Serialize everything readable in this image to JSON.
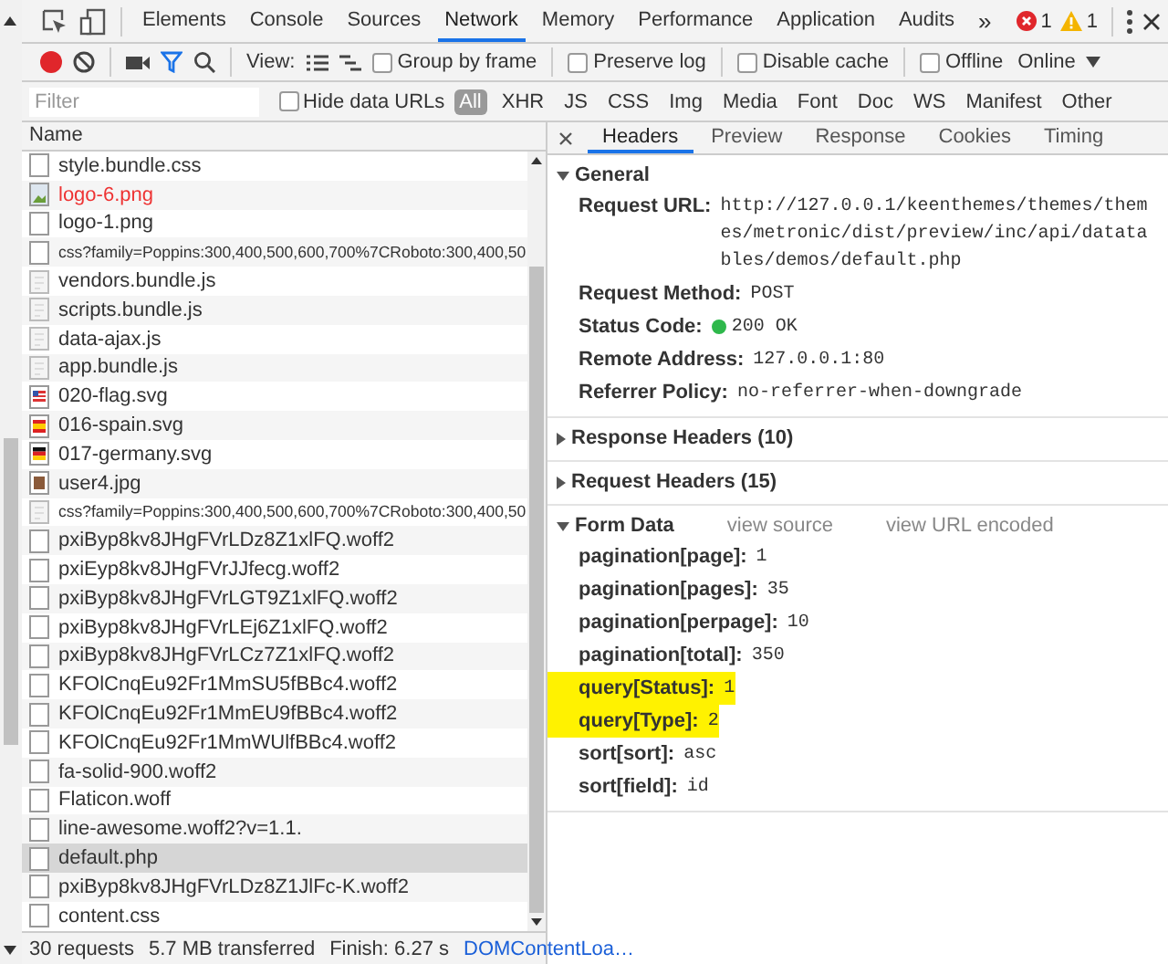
{
  "devtools_tabs": [
    {
      "label": "Elements",
      "selected": false
    },
    {
      "label": "Console",
      "selected": false
    },
    {
      "label": "Sources",
      "selected": false
    },
    {
      "label": "Network",
      "selected": true
    },
    {
      "label": "Memory",
      "selected": false
    },
    {
      "label": "Performance",
      "selected": false
    },
    {
      "label": "Application",
      "selected": false
    },
    {
      "label": "Audits",
      "selected": false
    }
  ],
  "more_tabs": "»",
  "error_count": "1",
  "warning_count": "1",
  "toolbar": {
    "view_label": "View:",
    "checkboxes": [
      {
        "label": "Group by frame",
        "checked": false
      },
      {
        "label": "Preserve log",
        "checked": false
      },
      {
        "label": "Disable cache",
        "checked": false
      },
      {
        "label": "Offline",
        "checked": false
      }
    ],
    "throttle": "Online"
  },
  "filter": {
    "placeholder": "Filter",
    "hide_data_urls": {
      "label": "Hide data URLs",
      "checked": false
    },
    "types": [
      {
        "label": "All",
        "selected": true
      },
      {
        "label": "XHR",
        "selected": false
      },
      {
        "label": "JS",
        "selected": false
      },
      {
        "label": "CSS",
        "selected": false
      },
      {
        "label": "Img",
        "selected": false
      },
      {
        "label": "Media",
        "selected": false
      },
      {
        "label": "Font",
        "selected": false
      },
      {
        "label": "Doc",
        "selected": false
      },
      {
        "label": "WS",
        "selected": false
      },
      {
        "label": "Manifest",
        "selected": false
      },
      {
        "label": "Other",
        "selected": false
      }
    ]
  },
  "requests": {
    "column": "Name",
    "rows": [
      {
        "name": "style.bundle.css",
        "kind": "doc",
        "failed": false,
        "selected": false
      },
      {
        "name": "logo-6.png",
        "kind": "broken-image",
        "failed": true,
        "selected": false
      },
      {
        "name": "logo-1.png",
        "kind": "doc",
        "failed": false,
        "selected": false
      },
      {
        "name": "css?family=Poppins:300,400,500,600,700%7CRoboto:300,400,50",
        "kind": "doc",
        "failed": false,
        "selected": false
      },
      {
        "name": "vendors.bundle.js",
        "kind": "script",
        "failed": false,
        "selected": false
      },
      {
        "name": "scripts.bundle.js",
        "kind": "script",
        "failed": false,
        "selected": false
      },
      {
        "name": "data-ajax.js",
        "kind": "script",
        "failed": false,
        "selected": false
      },
      {
        "name": "app.bundle.js",
        "kind": "script",
        "failed": false,
        "selected": false
      },
      {
        "name": "020-flag.svg",
        "kind": "flag-us",
        "failed": false,
        "selected": false
      },
      {
        "name": "016-spain.svg",
        "kind": "flag-es",
        "failed": false,
        "selected": false
      },
      {
        "name": "017-germany.svg",
        "kind": "flag-de",
        "failed": false,
        "selected": false
      },
      {
        "name": "user4.jpg",
        "kind": "photo",
        "failed": false,
        "selected": false
      },
      {
        "name": "css?family=Poppins:300,400,500,600,700%7CRoboto:300,400,50",
        "kind": "script",
        "failed": false,
        "selected": false
      },
      {
        "name": "pxiByp8kv8JHgFVrLDz8Z1xlFQ.woff2",
        "kind": "doc",
        "failed": false,
        "selected": false
      },
      {
        "name": "pxiEyp8kv8JHgFVrJJfecg.woff2",
        "kind": "doc",
        "failed": false,
        "selected": false
      },
      {
        "name": "pxiByp8kv8JHgFVrLGT9Z1xlFQ.woff2",
        "kind": "doc",
        "failed": false,
        "selected": false
      },
      {
        "name": "pxiByp8kv8JHgFVrLEj6Z1xlFQ.woff2",
        "kind": "doc",
        "failed": false,
        "selected": false
      },
      {
        "name": "pxiByp8kv8JHgFVrLCz7Z1xlFQ.woff2",
        "kind": "doc",
        "failed": false,
        "selected": false
      },
      {
        "name": "KFOlCnqEu92Fr1MmSU5fBBc4.woff2",
        "kind": "doc",
        "failed": false,
        "selected": false
      },
      {
        "name": "KFOlCnqEu92Fr1MmEU9fBBc4.woff2",
        "kind": "doc",
        "failed": false,
        "selected": false
      },
      {
        "name": "KFOlCnqEu92Fr1MmWUlfBBc4.woff2",
        "kind": "doc",
        "failed": false,
        "selected": false
      },
      {
        "name": "fa-solid-900.woff2",
        "kind": "doc",
        "failed": false,
        "selected": false
      },
      {
        "name": "Flaticon.woff",
        "kind": "doc",
        "failed": false,
        "selected": false
      },
      {
        "name": "line-awesome.woff2?v=1.1.",
        "kind": "doc",
        "failed": false,
        "selected": false
      },
      {
        "name": "default.php",
        "kind": "doc",
        "failed": false,
        "selected": true
      },
      {
        "name": "pxiByp8kv8JHgFVrLDz8Z1JlFc-K.woff2",
        "kind": "doc",
        "failed": false,
        "selected": false
      },
      {
        "name": "content.css",
        "kind": "doc",
        "failed": false,
        "selected": false
      }
    ]
  },
  "status_bar": {
    "requests": "30 requests",
    "transferred": "5.7 MB transferred",
    "finish": "Finish: 6.27 s",
    "dom_content_loaded": "DOMContentLoa…"
  },
  "details": {
    "tabs": [
      {
        "label": "Headers",
        "selected": true
      },
      {
        "label": "Preview",
        "selected": false
      },
      {
        "label": "Response",
        "selected": false
      },
      {
        "label": "Cookies",
        "selected": false
      },
      {
        "label": "Timing",
        "selected": false
      }
    ],
    "sections": [
      {
        "title": "General",
        "expanded": true,
        "fields": [
          {
            "name": "Request URL:",
            "value": "http://127.0.0.1/keenthemes/themes/themes/metronic/dist/preview/inc/api/datatables/demos/default.php",
            "kind": "text",
            "highlighted": false
          },
          {
            "name": "Request Method:",
            "value": "POST",
            "kind": "text",
            "highlighted": false
          },
          {
            "name": "Status Code:",
            "value": "200 OK",
            "kind": "status",
            "highlighted": false
          },
          {
            "name": "Remote Address:",
            "value": "127.0.0.1:80",
            "kind": "text",
            "highlighted": false
          },
          {
            "name": "Referrer Policy:",
            "value": "no-referrer-when-downgrade",
            "kind": "text",
            "highlighted": false
          }
        ]
      },
      {
        "title": "Response Headers (10)",
        "expanded": false
      },
      {
        "title": "Request Headers (15)",
        "expanded": false
      },
      {
        "title": "Form Data",
        "expanded": true,
        "links": [
          "view source",
          "view URL encoded"
        ],
        "fields": [
          {
            "name": "pagination[page]:",
            "value": "1",
            "kind": "text",
            "highlighted": false
          },
          {
            "name": "pagination[pages]:",
            "value": "35",
            "kind": "text",
            "highlighted": false
          },
          {
            "name": "pagination[perpage]:",
            "value": "10",
            "kind": "text",
            "highlighted": false
          },
          {
            "name": "pagination[total]:",
            "value": "350",
            "kind": "text",
            "highlighted": false
          },
          {
            "name": "query[Status]:",
            "value": "1",
            "kind": "text",
            "highlighted": true
          },
          {
            "name": "query[Type]:",
            "value": "2",
            "kind": "text",
            "highlighted": true
          },
          {
            "name": "sort[sort]:",
            "value": "asc",
            "kind": "text",
            "highlighted": false
          },
          {
            "name": "sort[field]:",
            "value": "id",
            "kind": "text",
            "highlighted": false
          }
        ]
      }
    ]
  }
}
